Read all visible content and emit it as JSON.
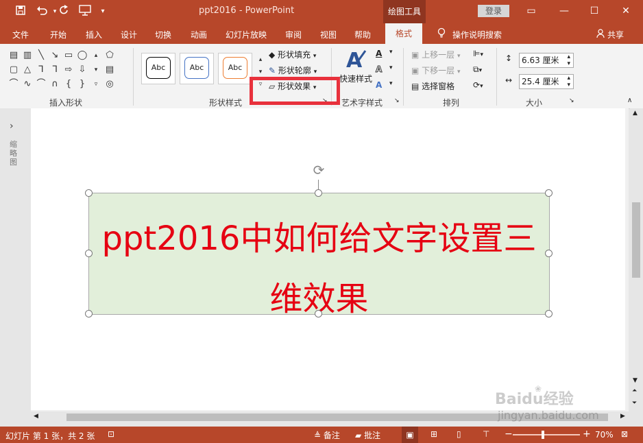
{
  "window": {
    "doc_title": "ppt2016  -  PowerPoint",
    "contextual_tab": "绘图工具",
    "login": "登录",
    "quick_access": [
      "save-icon",
      "undo-icon",
      "redo-icon",
      "present-icon",
      "customize-icon"
    ]
  },
  "tabs": [
    "文件",
    "开始",
    "插入",
    "设计",
    "切换",
    "动画",
    "幻灯片放映",
    "审阅",
    "视图",
    "帮助"
  ],
  "active_tab": "格式",
  "tell_me": "操作说明搜索",
  "share": "共享",
  "ribbon": {
    "insert_shapes": {
      "label": "插入形状"
    },
    "shape_styles": {
      "label": "形状样式",
      "previews": [
        {
          "text": "Abc",
          "border": "#000000"
        },
        {
          "text": "Abc",
          "border": "#4472c4"
        },
        {
          "text": "Abc",
          "border": "#ed7d31"
        }
      ],
      "fill": "形状填充",
      "outline": "形状轮廓",
      "effects": "形状效果"
    },
    "wordart": {
      "label": "艺术字样式",
      "quick_styles": "快速样式"
    },
    "arrange": {
      "label": "排列",
      "bring_forward": "上移一层",
      "send_backward": "下移一层",
      "selection_pane": "选择窗格"
    },
    "size": {
      "label": "大小",
      "height": "6.63 厘米",
      "width": "25.4 厘米"
    }
  },
  "left_pane": {
    "collapsed_label": "缩略图"
  },
  "slide": {
    "textbox_line1": "ppt2016中如何给文字设置三",
    "textbox_line2": "维效果",
    "textbox_text_color": "#e60012",
    "textbox_fill": "#e2efda"
  },
  "status": {
    "slide_info": "幻灯片 第 1 张，共 2 张",
    "notes": "备注",
    "comments": "批注",
    "zoom_level": "70%",
    "zoom_fraction": 0.45
  },
  "watermark": {
    "brand": "Baidu经验",
    "url": "jingyan.baidu.com"
  },
  "colors": {
    "accent": "#b7472a",
    "highlight": "#e8313c"
  }
}
